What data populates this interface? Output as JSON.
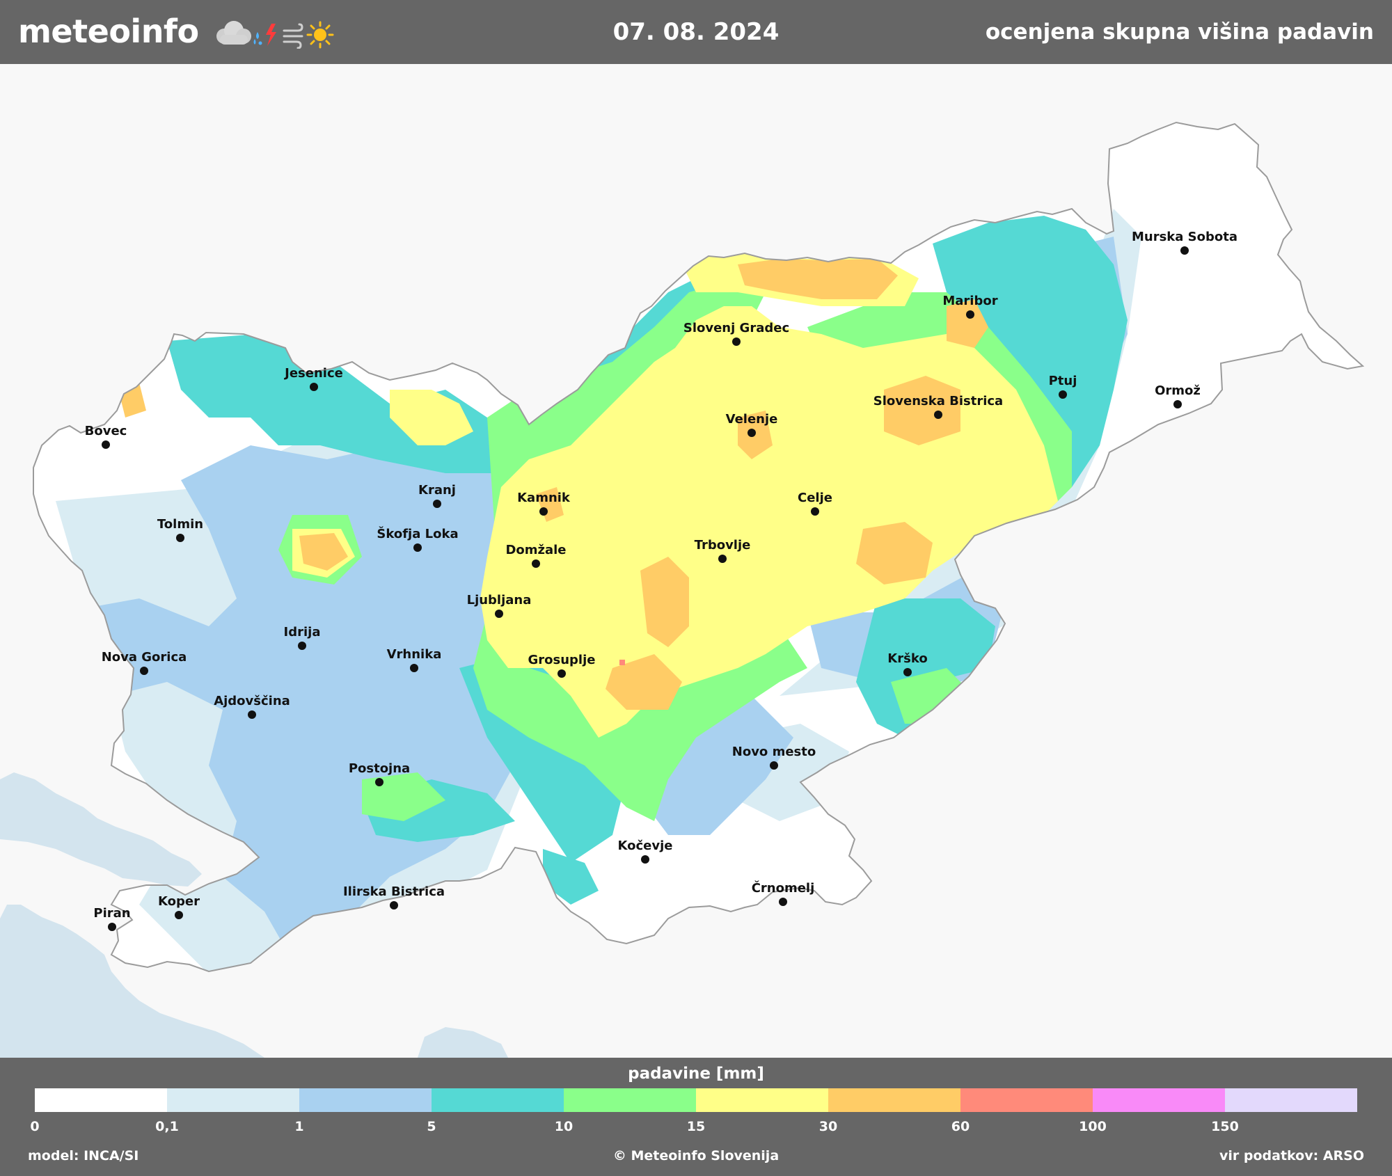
{
  "header": {
    "logo": "meteoinfo",
    "date": "07. 08. 2024",
    "title": "ocenjena skupna višina padavin",
    "icons": [
      "cloud-icon",
      "raindrop-icon",
      "lightning-icon",
      "wind-icon",
      "sun-icon"
    ]
  },
  "map": {
    "cities": [
      {
        "name": "Murska Sobota"
      },
      {
        "name": "Maribor"
      },
      {
        "name": "Slovenj Gradec"
      },
      {
        "name": "Ptuj"
      },
      {
        "name": "Ormož"
      },
      {
        "name": "Slovenska Bistrica"
      },
      {
        "name": "Velenje"
      },
      {
        "name": "Jesenice"
      },
      {
        "name": "Bovec"
      },
      {
        "name": "Kranj"
      },
      {
        "name": "Kamnik"
      },
      {
        "name": "Celje"
      },
      {
        "name": "Tolmin"
      },
      {
        "name": "Škofja Loka"
      },
      {
        "name": "Domžale"
      },
      {
        "name": "Trbovlje"
      },
      {
        "name": "Ljubljana"
      },
      {
        "name": "Idrija"
      },
      {
        "name": "Nova Gorica"
      },
      {
        "name": "Vrhnika"
      },
      {
        "name": "Grosuplje"
      },
      {
        "name": "Krško"
      },
      {
        "name": "Ajdovščina"
      },
      {
        "name": "Novo mesto"
      },
      {
        "name": "Postojna"
      },
      {
        "name": "Kočevje"
      },
      {
        "name": "Črnomelj"
      },
      {
        "name": "Ilirska Bistrica"
      },
      {
        "name": "Koper"
      },
      {
        "name": "Piran"
      }
    ]
  },
  "legend": {
    "title": "padavine [mm]",
    "colors": [
      "#ffffff",
      "#d9ecf3",
      "#a9d1f0",
      "#55d9d4",
      "#8aff8a",
      "#ffff88",
      "#ffcc66",
      "#ff8a7a",
      "#f98af8",
      "#e3d9fc"
    ],
    "ticks": [
      "0",
      "0,1",
      "1",
      "5",
      "10",
      "15",
      "30",
      "60",
      "100",
      "150"
    ]
  },
  "footer": {
    "model": "model: INCA/SI",
    "copyright": "© Meteoinfo Slovenija",
    "source": "vir podatkov: ARSO"
  }
}
